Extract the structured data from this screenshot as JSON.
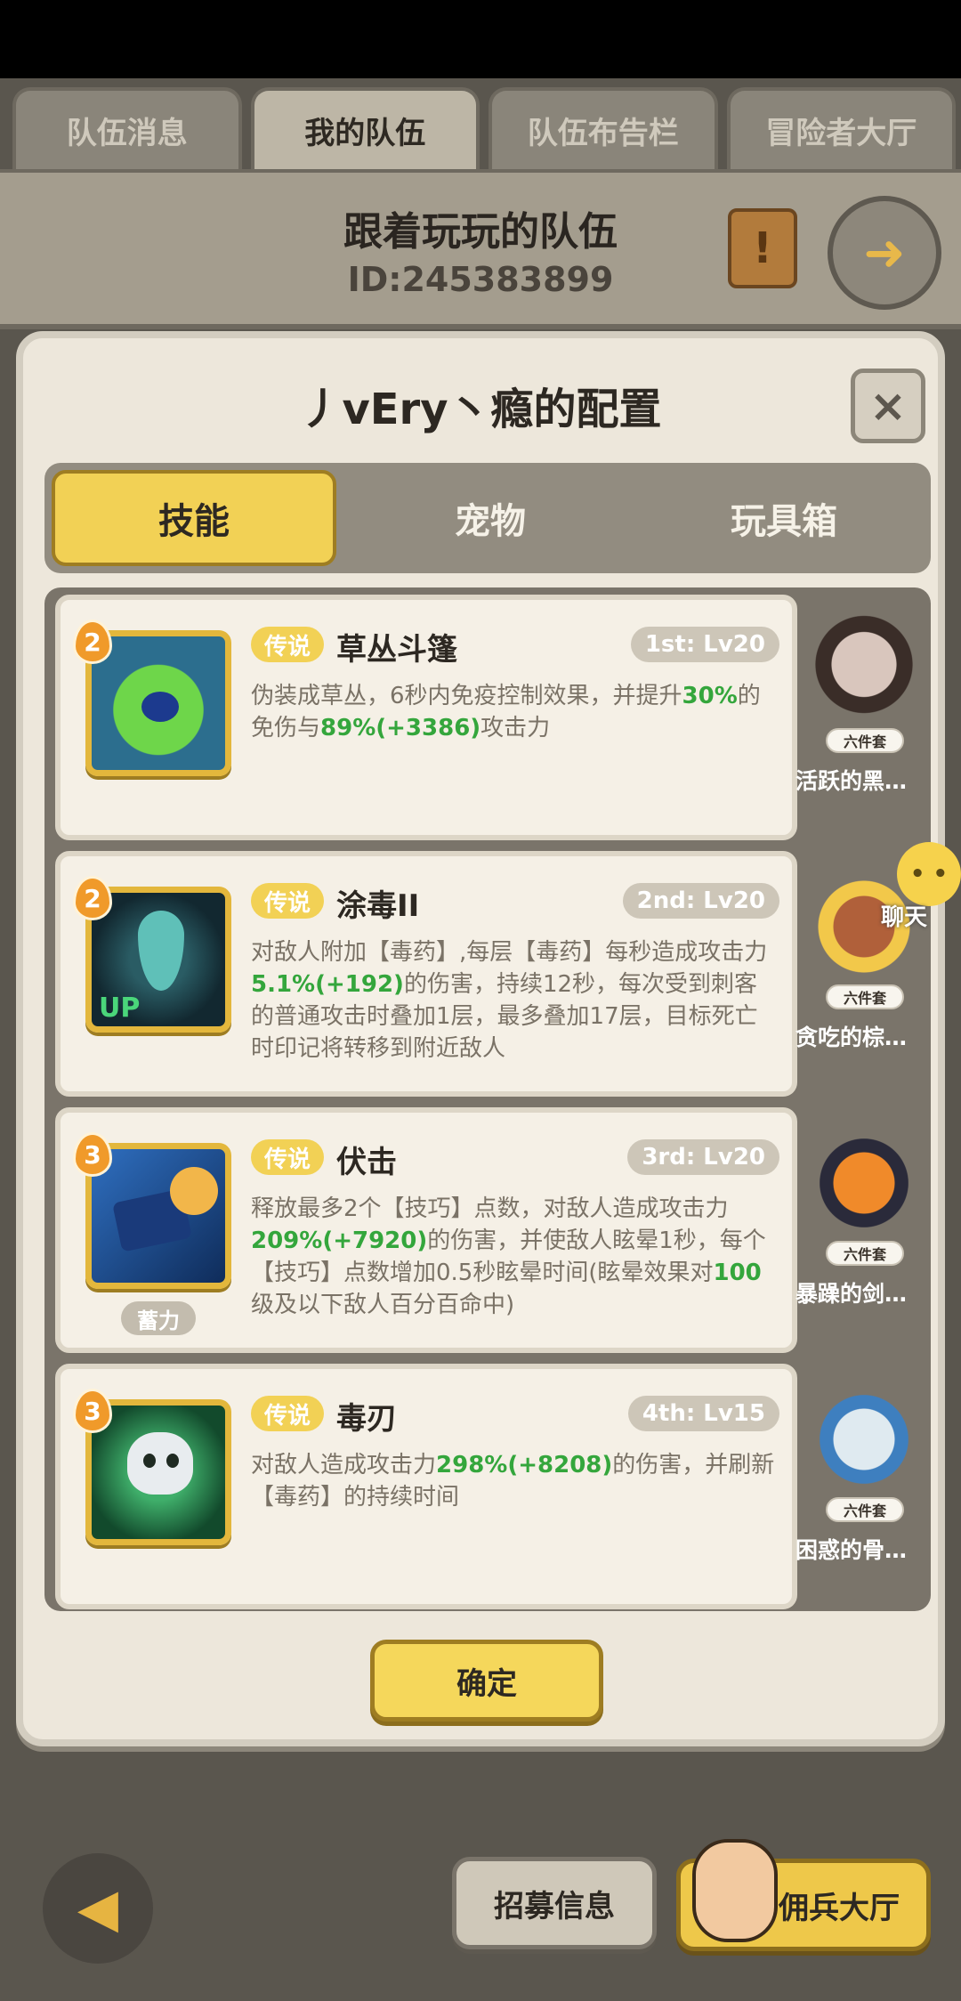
{
  "top_tabs": [
    "队伍消息",
    "我的队伍",
    "队伍布告栏",
    "冒险者大厅"
  ],
  "team": {
    "name": "跟着玩玩的队伍",
    "id": "ID:245383899"
  },
  "modal": {
    "title": "丿vEry丶瘾的配置",
    "close": "×",
    "tabs": [
      "技能",
      "宠物",
      "玩具箱"
    ],
    "confirm": "确定"
  },
  "skills": [
    {
      "rank": "2",
      "rarity": "传说",
      "name": "草丛斗篷",
      "level": "1st: Lv20",
      "desc": [
        "伪装成草丛，6秒内免疫控制效果，并提升",
        "30%",
        "的免伤与",
        "89%(+3386)",
        "攻击力"
      ],
      "pet_name": "活跃的黑…",
      "set_tag": "六件套",
      "icon_colors": [
        "#2c6e8e",
        "#6ed64a"
      ]
    },
    {
      "rank": "2",
      "rarity": "传说",
      "name": "涂毒II",
      "level": "2nd: Lv20",
      "desc": [
        "对敌人附加【毒药】,每层【毒药】每秒造成攻击力",
        "5.1%(+192)",
        "的伤害，持续12秒，每次受到刺客的普通攻击时叠加1层，最多叠加17层，目标死亡时印记将转移到附近敌人",
        "",
        ""
      ],
      "pet_name": "贪吃的棕…",
      "set_tag": "六件套",
      "icon_colors": [
        "#1c3a46",
        "#5fc0b8"
      ],
      "icon_text": "UP"
    },
    {
      "rank": "3",
      "rarity": "传说",
      "name": "伏击",
      "level": "3rd: Lv20",
      "desc": [
        "释放最多2个【技巧】点数，对敌人造成攻击力",
        "209%(+7920)",
        "的伤害，并使敌人眩晕1秒，每个【技巧】点数增加0.5秒眩晕时间(眩晕效果对",
        "100",
        "级及以下敌人百分百命中)"
      ],
      "pet_name": "暴躁的剑…",
      "set_tag": "六件套",
      "icon_colors": [
        "#1e4c8c",
        "#f2b64a"
      ],
      "charge": "蓄力"
    },
    {
      "rank": "3",
      "rarity": "传说",
      "name": "毒刃",
      "level": "4th: Lv15",
      "desc": [
        "对敌人造成攻击力",
        "298%(+8208)",
        "的伤害，并刷新【毒药】的持续时间",
        "",
        ""
      ],
      "pet_name": "困惑的骨…",
      "set_tag": "六件套",
      "icon_colors": [
        "#1f5c3a",
        "#e8ecef"
      ]
    }
  ],
  "chat": {
    "label": "聊天"
  },
  "bottom": {
    "back": "back-arrow",
    "recruit": "招募信息",
    "mercenary": "佣兵大厅"
  }
}
